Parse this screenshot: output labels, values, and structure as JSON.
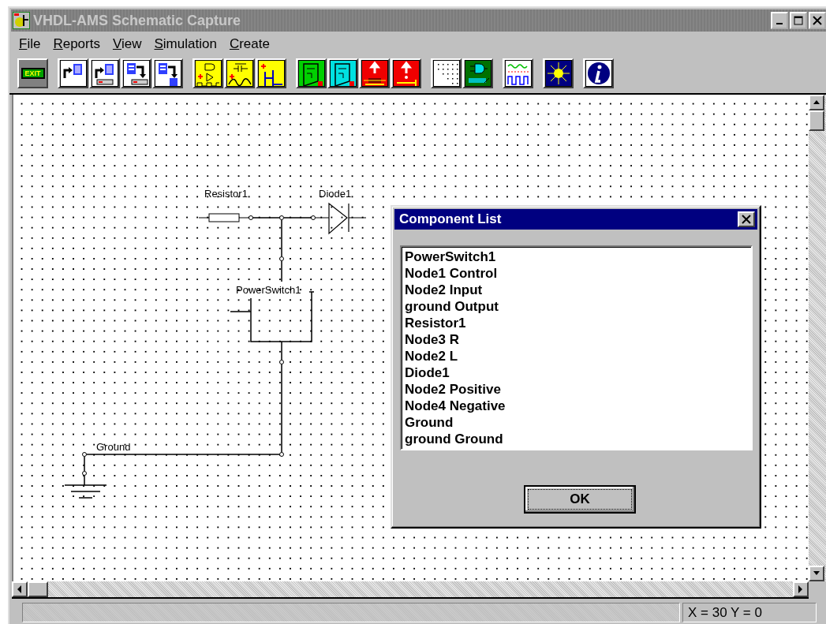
{
  "window": {
    "title": "VHDL-AMS Schematic Capture"
  },
  "menu": [
    {
      "label": "File"
    },
    {
      "label": "Reports"
    },
    {
      "label": "View"
    },
    {
      "label": "Simulation"
    },
    {
      "label": "Create"
    }
  ],
  "toolbar": [
    [
      {
        "kind": "exit",
        "label": "EXIT"
      }
    ],
    [
      {
        "kind": "new-doc"
      },
      {
        "kind": "open-doc"
      },
      {
        "kind": "save-doc"
      },
      {
        "kind": "save-as-doc"
      }
    ],
    [
      {
        "kind": "digital"
      },
      {
        "kind": "analog"
      },
      {
        "kind": "bus"
      }
    ],
    [
      {
        "kind": "component"
      },
      {
        "kind": "node"
      },
      {
        "kind": "resistor"
      },
      {
        "kind": "probe"
      }
    ],
    [
      {
        "kind": "grid"
      },
      {
        "kind": "gate"
      }
    ],
    [
      {
        "kind": "waveform"
      }
    ],
    [
      {
        "kind": "sun"
      }
    ],
    [
      {
        "kind": "info"
      }
    ]
  ],
  "schematic": {
    "labels": [
      {
        "kind": "resistor",
        "text": "Resistor1"
      },
      {
        "kind": "diode",
        "text": "Diode1"
      },
      {
        "kind": "switch",
        "text": "PowerSwitch1"
      },
      {
        "kind": "ground",
        "text": "Ground"
      }
    ]
  },
  "dialog": {
    "title": "Component List",
    "items": [
      "PowerSwitch1",
      "Node1 Control",
      "Node2 Input",
      "ground Output",
      "Resistor1",
      "Node3 R",
      "Node2 L",
      "Diode1",
      "Node2 Positive",
      "Node4 Negative",
      "Ground",
      "ground Ground"
    ],
    "button": "OK"
  },
  "status_bar": {
    "coordinates": "X = 30 Y = 0"
  }
}
